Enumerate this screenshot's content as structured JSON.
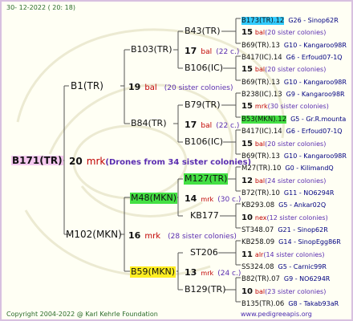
{
  "header": {
    "date": "30- 12-2022 ( 20: 18)"
  },
  "root": {
    "name": "B171(TR)",
    "count": "20",
    "mark": "mrk",
    "note": "(Drones from 34 sister colonies)"
  },
  "g1": [
    {
      "name": "B1(TR)",
      "count": "19",
      "mark": "bal",
      "note": "(20 sister colonies)"
    },
    {
      "name": "M102(MKN)",
      "count": "16",
      "mark": "mrk",
      "note": "(28 sister colonies)"
    }
  ],
  "g2": [
    {
      "name": "B103(TR)",
      "count": "17",
      "mark": "bal",
      "note": "(22 c.)"
    },
    {
      "name": "B84(TR)",
      "count": "17",
      "mark": "bal",
      "note": "(22 c.)"
    },
    {
      "name": "M48(MKN)",
      "count": "14",
      "mark": "mrk",
      "note": "(30 c.)"
    },
    {
      "name": "B59(MKN)",
      "count": "13",
      "mark": "mrk",
      "note": "(24 c.)"
    }
  ],
  "g3": [
    {
      "name": "B43(TR)",
      "count": "",
      "mark": "",
      "note": ""
    },
    {
      "name": "B106(IC)",
      "count": "",
      "mark": "",
      "note": ""
    },
    {
      "name": "B79(TR)",
      "count": "",
      "mark": "",
      "note": ""
    },
    {
      "name": "B106(IC)",
      "count": "",
      "mark": "",
      "note": ""
    },
    {
      "name": "M127(TR)",
      "count": "",
      "mark": "",
      "note": ""
    },
    {
      "name": "KB177",
      "count": "",
      "mark": "",
      "note": ""
    },
    {
      "name": "ST206",
      "count": "",
      "mark": "",
      "note": ""
    },
    {
      "name": "B129(TR)",
      "count": "",
      "mark": "",
      "note": ""
    }
  ],
  "g4": [
    {
      "name": "B173(TR).12",
      "info": "G26 - Sinop62R"
    },
    {
      "count": "15",
      "mark": "bal",
      "note": "(20 sister colonies)"
    },
    {
      "name": "B69(TR).13",
      "info": "G10 - Kangaroo98R"
    },
    {
      "name": "B417(IC).14",
      "info": "G6 - Erfoud07-1Q"
    },
    {
      "count": "15",
      "mark": "bal",
      "note": "(20 sister colonies)"
    },
    {
      "name": "B69(TR).13",
      "info": "G10 - Kangaroo98R"
    },
    {
      "name": "B238(IC).13",
      "info": "G9 - Kangaroo98R"
    },
    {
      "count": "15",
      "mark": "mrk",
      "note": "(30 sister colonies)"
    },
    {
      "name": "B53(MKN).12",
      "info": "G5 - Gr.R.mounta"
    },
    {
      "name": "B417(IC).14",
      "info": "G6 - Erfoud07-1Q"
    },
    {
      "count": "15",
      "mark": "bal",
      "note": "(20 sister colonies)"
    },
    {
      "name": "B69(TR).13",
      "info": "G10 - Kangaroo98R"
    },
    {
      "name": "M27(TR).10",
      "info": "G0 - KilimandQ"
    },
    {
      "count": "12",
      "mark": "bal",
      "note": "(24 sister colonies)"
    },
    {
      "name": "B72(TR).10",
      "info": "G11 - NO6294R"
    },
    {
      "name": "KB293.08",
      "info": "G5 - Ankar02Q"
    },
    {
      "count": "10",
      "mark": "nex",
      "note": "(12 sister colonies)"
    },
    {
      "name": "ST348.07",
      "info": "G21 - Sinop62R"
    },
    {
      "name": "KB258.09",
      "info": "G14 - SinopEgg86R"
    },
    {
      "count": "11",
      "mark": "alr",
      "note": "(14 sister colonies)"
    },
    {
      "name": "SS324.08",
      "info": "G5 - Carnic99R"
    },
    {
      "name": "B82(TR).07",
      "info": "G9 - NO6294R"
    },
    {
      "count": "10",
      "mark": "bal",
      "note": "(23 sister colonies)"
    },
    {
      "name": "B135(TR).06",
      "info": "G8 - Takab93aR"
    }
  ],
  "footer": {
    "copyright": "Copyright 2004-2022 @ Karl Kehrle Foundation",
    "url": "www.pedigreeapis.org"
  },
  "colors": {
    "cyan": "#33ccff",
    "green": "#44e044",
    "yellow": "#ffee22",
    "pink": "#f5c9f0",
    "red": "#c00000",
    "navy": "#000080"
  }
}
